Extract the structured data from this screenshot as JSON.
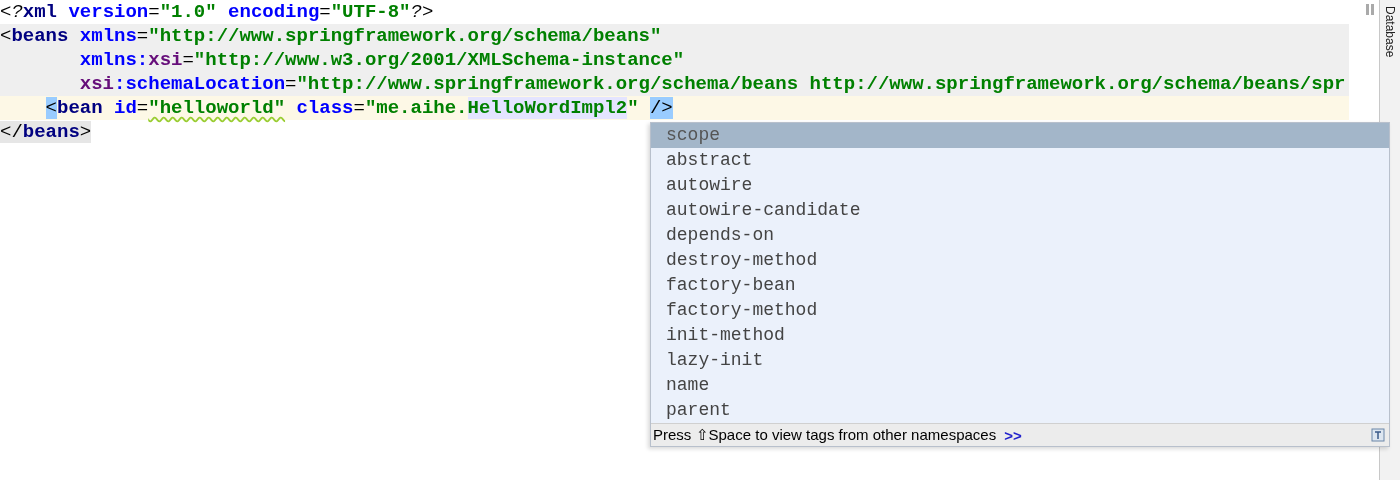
{
  "editor": {
    "lines": [
      {
        "highlighted": false,
        "current": false,
        "tokens": [
          {
            "kind": "pi",
            "text": "<?"
          },
          {
            "kind": "tag",
            "text": "xml"
          },
          {
            "kind": "attr",
            "text": " version"
          },
          {
            "kind": "plain",
            "text": "="
          },
          {
            "kind": "value",
            "text": "\"1.0\""
          },
          {
            "kind": "attr",
            "text": " encoding"
          },
          {
            "kind": "plain",
            "text": "="
          },
          {
            "kind": "value",
            "text": "\"UTF-8\""
          },
          {
            "kind": "pi",
            "text": "?>"
          }
        ]
      },
      {
        "highlighted": true,
        "current": false,
        "tokens": [
          {
            "kind": "plain",
            "text": "<"
          },
          {
            "kind": "tag",
            "text": "beans"
          },
          {
            "kind": "attr",
            "text": " xmlns"
          },
          {
            "kind": "plain",
            "text": "="
          },
          {
            "kind": "value",
            "text": "\"http://www.springframework.org/schema/beans\""
          }
        ]
      },
      {
        "highlighted": true,
        "current": false,
        "tokens": [
          {
            "kind": "attr",
            "text": "       xmlns:"
          },
          {
            "kind": "ns",
            "text": "xsi"
          },
          {
            "kind": "plain",
            "text": "="
          },
          {
            "kind": "value",
            "text": "\"http://www.w3.org/2001/XMLSchema-instance\""
          }
        ]
      },
      {
        "highlighted": true,
        "current": false,
        "tokens": [
          {
            "kind": "ns",
            "text": "       xsi"
          },
          {
            "kind": "attr",
            "text": ":schemaLocation"
          },
          {
            "kind": "plain",
            "text": "="
          },
          {
            "kind": "value",
            "text": "\"http://www.springframework.org/schema/beans http://www.springframework.org/schema/beans/spr"
          }
        ]
      },
      {
        "highlighted": false,
        "current": true,
        "kind": "child",
        "tokens": [
          {
            "kind": "brace",
            "text": "<"
          },
          {
            "kind": "tag",
            "text": "bean"
          },
          {
            "kind": "attr",
            "text": " id"
          },
          {
            "kind": "plain",
            "text": "="
          },
          {
            "kind": "typo",
            "text": "\"helloworld\""
          },
          {
            "kind": "attr",
            "text": " class"
          },
          {
            "kind": "plain",
            "text": "="
          },
          {
            "kind": "value",
            "text": "\"me.aihe."
          },
          {
            "kind": "ref",
            "text": "HelloWordImpl2"
          },
          {
            "kind": "value",
            "text": "\" "
          },
          {
            "kind": "brace",
            "text": "/>"
          }
        ]
      },
      {
        "highlighted": false,
        "current": false,
        "tokens": [
          {
            "kind": "scopepunct",
            "text": "</"
          },
          {
            "kind": "scopetag",
            "text": "beans"
          },
          {
            "kind": "scopepunct",
            "text": ">"
          }
        ]
      }
    ]
  },
  "completion": {
    "items": [
      {
        "label": "scope",
        "selected": true
      },
      {
        "label": "abstract",
        "selected": false
      },
      {
        "label": "autowire",
        "selected": false
      },
      {
        "label": "autowire-candidate",
        "selected": false
      },
      {
        "label": "depends-on",
        "selected": false
      },
      {
        "label": "destroy-method",
        "selected": false
      },
      {
        "label": "factory-bean",
        "selected": false
      },
      {
        "label": "factory-method",
        "selected": false
      },
      {
        "label": "init-method",
        "selected": false
      },
      {
        "label": "lazy-init",
        "selected": false
      },
      {
        "label": "name",
        "selected": false
      },
      {
        "label": "parent",
        "selected": false
      }
    ],
    "hint": "Press ⇧Space to view tags from other namespaces",
    "hint_link": ">>"
  },
  "side_tabs": [
    {
      "label": "Database"
    }
  ]
}
